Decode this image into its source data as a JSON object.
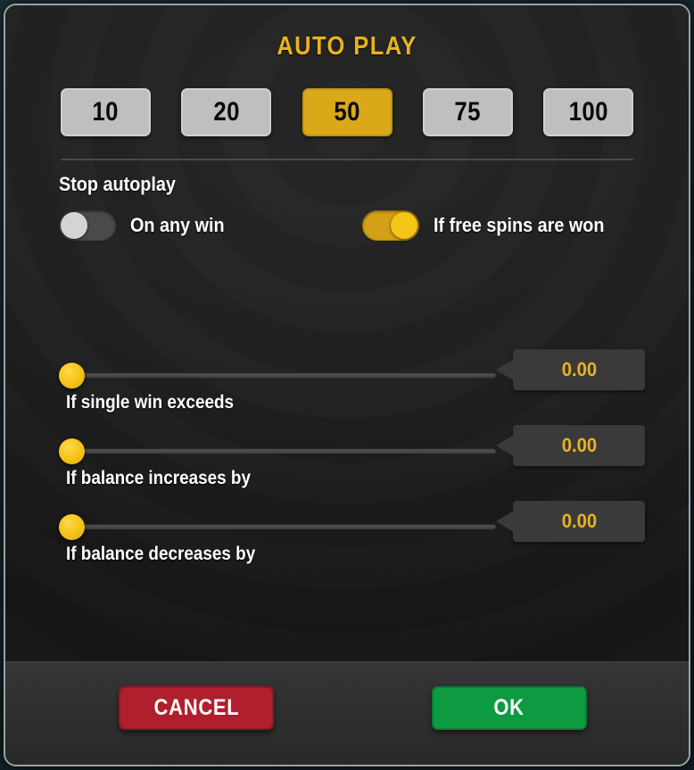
{
  "dialog": {
    "title": "AUTO PLAY"
  },
  "presets": {
    "options": [
      {
        "label": "10",
        "selected": false
      },
      {
        "label": "20",
        "selected": false
      },
      {
        "label": "50",
        "selected": true
      },
      {
        "label": "75",
        "selected": false
      },
      {
        "label": "100",
        "selected": false
      }
    ]
  },
  "stop_autoplay": {
    "heading": "Stop autoplay",
    "toggles": [
      {
        "label": "On any win",
        "state": "off"
      },
      {
        "label": "If free spins are won",
        "state": "on"
      }
    ]
  },
  "sliders": [
    {
      "label": "If single win exceeds",
      "value": "0.00",
      "position_percent": 0
    },
    {
      "label": "If balance increases by",
      "value": "0.00",
      "position_percent": 0
    },
    {
      "label": "If balance decreases by",
      "value": "0.00",
      "position_percent": 0
    }
  ],
  "footer": {
    "cancel_label": "CANCEL",
    "ok_label": "OK"
  },
  "colors": {
    "accent_gold": "#E8B31E",
    "knob_gold": "#F5C518",
    "selected_preset": "#D9A91A",
    "preset_gray": "#BFBFBF",
    "cancel_red": "#B01F2E",
    "ok_green": "#0E9A41",
    "panel_bg": "#1E1E1E",
    "footer_bg": "#2F2F2F"
  }
}
